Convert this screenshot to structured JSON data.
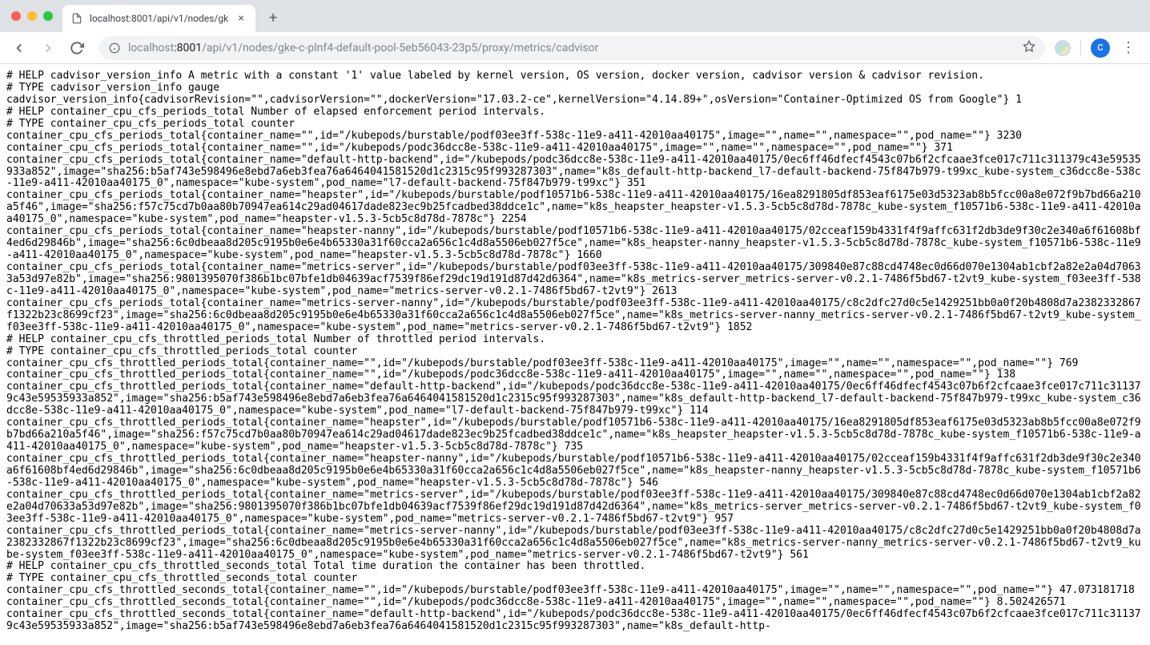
{
  "tab": {
    "title": "localhost:8001/api/v1/nodes/gk"
  },
  "address": {
    "host_dim": "localhost",
    "port": ":8001",
    "path": "/api/v1/nodes/gke-c-plnf4-default-pool-5eb56043-23p5/proxy/metrics/cadvisor"
  },
  "avatar": {
    "letter": "C"
  },
  "metrics_text": "# HELP cadvisor_version_info A metric with a constant '1' value labeled by kernel version, OS version, docker version, cadvisor version & cadvisor revision.\n# TYPE cadvisor_version_info gauge\ncadvisor_version_info{cadvisorRevision=\"\",cadvisorVersion=\"\",dockerVersion=\"17.03.2-ce\",kernelVersion=\"4.14.89+\",osVersion=\"Container-Optimized OS from Google\"} 1\n# HELP container_cpu_cfs_periods_total Number of elapsed enforcement period intervals.\n# TYPE container_cpu_cfs_periods_total counter\ncontainer_cpu_cfs_periods_total{container_name=\"\",id=\"/kubepods/burstable/podf03ee3ff-538c-11e9-a411-42010aa40175\",image=\"\",name=\"\",namespace=\"\",pod_name=\"\"} 3230\ncontainer_cpu_cfs_periods_total{container_name=\"\",id=\"/kubepods/podc36dcc8e-538c-11e9-a411-42010aa40175\",image=\"\",name=\"\",namespace=\"\",pod_name=\"\"} 371\ncontainer_cpu_cfs_periods_total{container_name=\"default-http-backend\",id=\"/kubepods/podc36dcc8e-538c-11e9-a411-42010aa40175/0ec6ff46dfecf4543c07b6f2cfcaae3fce017c711c311379c43e59535933a852\",image=\"sha256:b5af743e598496e8ebd7a6eb3fea76a6464041581520d1c2315c95f993287303\",name=\"k8s_default-http-backend_l7-default-backend-75f847b979-t99xc_kube-system_c36dcc8e-538c-11e9-a411-42010aa40175_0\",namespace=\"kube-system\",pod_name=\"l7-default-backend-75f847b979-t99xc\"} 351\ncontainer_cpu_cfs_periods_total{container_name=\"heapster\",id=\"/kubepods/burstable/podf10571b6-538c-11e9-a411-42010aa40175/16ea8291805df853eaf6175e03d5323ab8b5fcc00a8e072f9b7bd66a210a5f46\",image=\"sha256:f57c75cd7b0aa80b70947ea614c29ad04617dade823ec9b25fcadbed38ddce1c\",name=\"k8s_heapster_heapster-v1.5.3-5cb5c8d78d-7878c_kube-system_f10571b6-538c-11e9-a411-42010aa40175_0\",namespace=\"kube-system\",pod_name=\"heapster-v1.5.3-5cb5c8d78d-7878c\"} 2254\ncontainer_cpu_cfs_periods_total{container_name=\"heapster-nanny\",id=\"/kubepods/burstable/podf10571b6-538c-11e9-a411-42010aa40175/02cceaf159b4331f4f9affc631f2db3de9f30c2e340a6f61608bf4ed6d29846b\",image=\"sha256:6c0dbeaa8d205c9195b0e6e4b65330a31f60cca2a656c1c4d8a5506eb027f5ce\",name=\"k8s_heapster-nanny_heapster-v1.5.3-5cb5c8d78d-7878c_kube-system_f10571b6-538c-11e9-a411-42010aa40175_0\",namespace=\"kube-system\",pod_name=\"heapster-v1.5.3-5cb5c8d78d-7878c\"} 1660\ncontainer_cpu_cfs_periods_total{container_name=\"metrics-server\",id=\"/kubepods/burstable/podf03ee3ff-538c-11e9-a411-42010aa40175/309840e87c88cd4748ec0d66d070e1304ab1cbf2a82e2a04d70633a53d97e82b\",image=\"sha256:9801395070f386b1bc07bfe1db04639acf7539f86ef29dc19d191d87d42d6364\",name=\"k8s_metrics-server_metrics-server-v0.2.1-7486f5bd67-t2vt9_kube-system_f03ee3ff-538c-11e9-a411-42010aa40175_0\",namespace=\"kube-system\",pod_name=\"metrics-server-v0.2.1-7486f5bd67-t2vt9\"} 2613\ncontainer_cpu_cfs_periods_total{container_name=\"metrics-server-nanny\",id=\"/kubepods/burstable/podf03ee3ff-538c-11e9-a411-42010aa40175/c8c2dfc27d0c5e1429251bb0a0f20b4808d7a2382332867f1322b23c8699cf23\",image=\"sha256:6c0dbeaa8d205c9195b0e6e4b65330a31f60cca2a656c1c4d8a5506eb027f5ce\",name=\"k8s_metrics-server-nanny_metrics-server-v0.2.1-7486f5bd67-t2vt9_kube-system_f03ee3ff-538c-11e9-a411-42010aa40175_0\",namespace=\"kube-system\",pod_name=\"metrics-server-v0.2.1-7486f5bd67-t2vt9\"} 1852\n# HELP container_cpu_cfs_throttled_periods_total Number of throttled period intervals.\n# TYPE container_cpu_cfs_throttled_periods_total counter\ncontainer_cpu_cfs_throttled_periods_total{container_name=\"\",id=\"/kubepods/burstable/podf03ee3ff-538c-11e9-a411-42010aa40175\",image=\"\",name=\"\",namespace=\"\",pod_name=\"\"} 769\ncontainer_cpu_cfs_throttled_periods_total{container_name=\"\",id=\"/kubepods/podc36dcc8e-538c-11e9-a411-42010aa40175\",image=\"\",name=\"\",namespace=\"\",pod_name=\"\"} 138\ncontainer_cpu_cfs_throttled_periods_total{container_name=\"default-http-backend\",id=\"/kubepods/podc36dcc8e-538c-11e9-a411-42010aa40175/0ec6ff46dfecf4543c07b6f2cfcaae3fce017c711c311379c43e59535933a852\",image=\"sha256:b5af743e598496e8ebd7a6eb3fea76a6464041581520d1c2315c95f993287303\",name=\"k8s_default-http-backend_l7-default-backend-75f847b979-t99xc_kube-system_c36dcc8e-538c-11e9-a411-42010aa40175_0\",namespace=\"kube-system\",pod_name=\"l7-default-backend-75f847b979-t99xc\"} 114\ncontainer_cpu_cfs_throttled_periods_total{container_name=\"heapster\",id=\"/kubepods/burstable/podf10571b6-538c-11e9-a411-42010aa40175/16ea8291805df853eaf6175e03d5323ab8b5fcc00a8e072f9b7bd66a210a5f46\",image=\"sha256:f57c75cd7b0aa80b70947ea614c29ad04617dade823ec9b25fcadbed38ddce1c\",name=\"k8s_heapster_heapster-v1.5.3-5cb5c8d78d-7878c_kube-system_f10571b6-538c-11e9-a411-42010aa40175_0\",namespace=\"kube-system\",pod_name=\"heapster-v1.5.3-5cb5c8d78d-7878c\"} 735\ncontainer_cpu_cfs_throttled_periods_total{container_name=\"heapster-nanny\",id=\"/kubepods/burstable/podf10571b6-538c-11e9-a411-42010aa40175/02cceaf159b4331f4f9affc631f2db3de9f30c2e340a6f61608bf4ed6d29846b\",image=\"sha256:6c0dbeaa8d205c9195b0e6e4b65330a31f60cca2a656c1c4d8a5506eb027f5ce\",name=\"k8s_heapster-nanny_heapster-v1.5.3-5cb5c8d78d-7878c_kube-system_f10571b6-538c-11e9-a411-42010aa40175_0\",namespace=\"kube-system\",pod_name=\"heapster-v1.5.3-5cb5c8d78d-7878c\"} 546\ncontainer_cpu_cfs_throttled_periods_total{container_name=\"metrics-server\",id=\"/kubepods/burstable/podf03ee3ff-538c-11e9-a411-42010aa40175/309840e87c88cd4748ec0d66d070e1304ab1cbf2a82e2a04d70633a53d97e82b\",image=\"sha256:9801395070f386b1bc07bfe1db04639acf7539f86ef29dc19d191d87d42d6364\",name=\"k8s_metrics-server_metrics-server-v0.2.1-7486f5bd67-t2vt9_kube-system_f03ee3ff-538c-11e9-a411-42010aa40175_0\",namespace=\"kube-system\",pod_name=\"metrics-server-v0.2.1-7486f5bd67-t2vt9\"} 957\ncontainer_cpu_cfs_throttled_periods_total{container_name=\"metrics-server-nanny\",id=\"/kubepods/burstable/podf03ee3ff-538c-11e9-a411-42010aa40175/c8c2dfc27d0c5e1429251bb0a0f20b4808d7a2382332867f1322b23c8699cf23\",image=\"sha256:6c0dbeaa8d205c9195b0e6e4b65330a31f60cca2a656c1c4d8a5506eb027f5ce\",name=\"k8s_metrics-server-nanny_metrics-server-v0.2.1-7486f5bd67-t2vt9_kube-system_f03ee3ff-538c-11e9-a411-42010aa40175_0\",namespace=\"kube-system\",pod_name=\"metrics-server-v0.2.1-7486f5bd67-t2vt9\"} 561\n# HELP container_cpu_cfs_throttled_seconds_total Total time duration the container has been throttled.\n# TYPE container_cpu_cfs_throttled_seconds_total counter\ncontainer_cpu_cfs_throttled_seconds_total{container_name=\"\",id=\"/kubepods/burstable/podf03ee3ff-538c-11e9-a411-42010aa40175\",image=\"\",name=\"\",namespace=\"\",pod_name=\"\"} 47.073181718\ncontainer_cpu_cfs_throttled_seconds_total{container_name=\"\",id=\"/kubepods/podc36dcc8e-538c-11e9-a411-42010aa40175\",image=\"\",name=\"\",namespace=\"\",pod_name=\"\"} 8.502426571\ncontainer_cpu_cfs_throttled_seconds_total{container_name=\"default-http-backend\",id=\"/kubepods/podc36dcc8e-538c-11e9-a411-42010aa40175/0ec6ff46dfecf4543c07b6f2cfcaae3fce017c711c311379c43e59535933a852\",image=\"sha256:b5af743e598496e8ebd7a6eb3fea76a6464041581520d1c2315c95f993287303\",name=\"k8s_default-http-"
}
